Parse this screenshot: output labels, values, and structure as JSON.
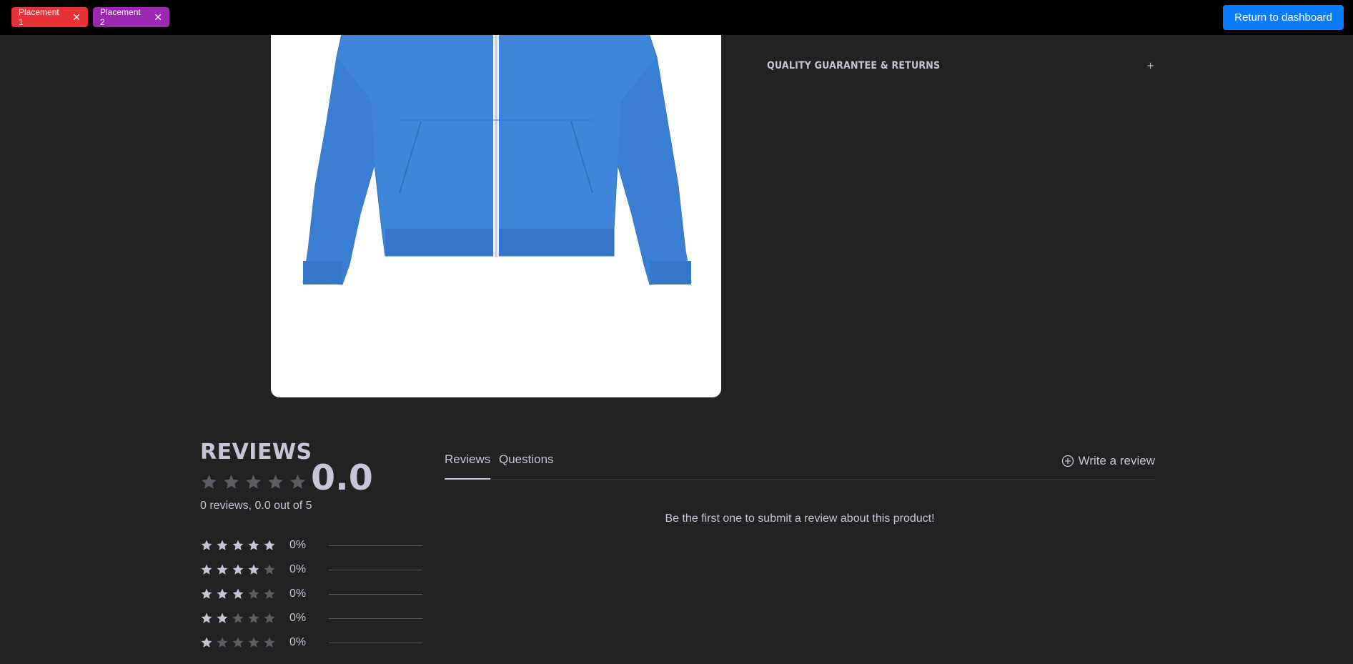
{
  "topbar": {
    "placements": [
      {
        "label": "Placement 1",
        "color": "#e8323a"
      },
      {
        "label": "Placement 2",
        "color": "#9c27b0"
      }
    ],
    "dashboard_button": "Return to dashboard"
  },
  "product": {
    "image_alt": "Blue zip-up jacket",
    "accordion_title": "QUALITY GUARANTEE & RETURNS",
    "accordion_icon": "+"
  },
  "reviews": {
    "title": "REVIEWS",
    "average": "0.0",
    "average_stars": 5,
    "summary": "0 reviews, 0.0 out of 5",
    "distribution": [
      {
        "stars": 5,
        "percent": "0%",
        "fraction": 0
      },
      {
        "stars": 4,
        "percent": "0%",
        "fraction": 0
      },
      {
        "stars": 3,
        "percent": "0%",
        "fraction": 0
      },
      {
        "stars": 2,
        "percent": "0%",
        "fraction": 0
      },
      {
        "stars": 1,
        "percent": "0%",
        "fraction": 0
      }
    ],
    "tabs": [
      {
        "label": "Reviews",
        "active": true
      },
      {
        "label": "Questions",
        "active": false
      }
    ],
    "write_review": "Write a review",
    "empty_message": "Be the first one to submit a review about this product!"
  },
  "colors": {
    "accent": "#0a7cff",
    "background": "#222223",
    "star_filled": "#c6c6d8",
    "star_empty": "#5c5c64"
  }
}
